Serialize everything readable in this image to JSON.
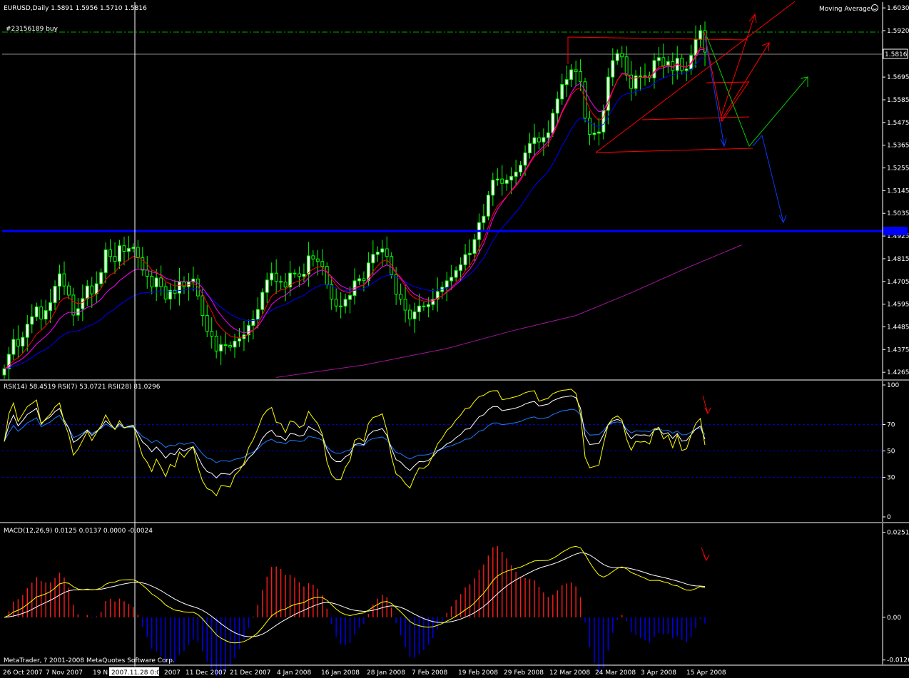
{
  "chart_data": [
    {
      "type": "candlestick",
      "title": "EURUSD,Daily  1.5891 1.5956 1.5710 1.5816",
      "indicator_label": "Moving Average",
      "order_label": "#23156189 buy",
      "current_price_label": "1.5816",
      "level_label": "1.4950",
      "ylim": [
        1.4238,
        1.6058
      ],
      "ticks": [
        1.603,
        1.592,
        1.5805,
        1.5695,
        1.5585,
        1.5475,
        1.5365,
        1.5255,
        1.5145,
        1.5035,
        1.4925,
        1.4815,
        1.4705,
        1.4595,
        1.4485,
        1.4375,
        1.4265
      ],
      "tick_labels": [
        "1.6030",
        "1.5920",
        "",
        "1.5695",
        "1.5585",
        "1.5475",
        "1.5365",
        "1.5255",
        "1.5145",
        "1.5035",
        "1.4925",
        "1.4815",
        "1.4705",
        "1.4595",
        "1.4485",
        "1.4375",
        "1.4265"
      ],
      "order_level": 1.5925,
      "current_price": 1.5816,
      "horizontal_level": 1.495,
      "closes": [
        1.4282,
        1.4352,
        1.4424,
        1.4392,
        1.4434,
        1.4498,
        1.4534,
        1.4582,
        1.4523,
        1.4564,
        1.4602,
        1.4682,
        1.4742,
        1.4683,
        1.4639,
        1.4542,
        1.4573,
        1.4622,
        1.4683,
        1.4645,
        1.4694,
        1.4748,
        1.4858,
        1.4826,
        1.4802,
        1.4878,
        1.4851,
        1.4865,
        1.487,
        1.482,
        1.476,
        1.473,
        1.4679,
        1.4722,
        1.468,
        1.462,
        1.4662,
        1.4648,
        1.4702,
        1.468,
        1.4702,
        1.4717,
        1.4635,
        1.454,
        1.4463,
        1.444,
        1.4368,
        1.4399,
        1.4395,
        1.4387,
        1.4416,
        1.4428,
        1.4446,
        1.4492,
        1.4521,
        1.4569,
        1.4652,
        1.4712,
        1.4745,
        1.4705,
        1.4702,
        1.4678,
        1.4745,
        1.4742,
        1.473,
        1.474,
        1.4829,
        1.4814,
        1.4802,
        1.4778,
        1.469,
        1.4619,
        1.4586,
        1.4586,
        1.4618,
        1.4637,
        1.4708,
        1.4718,
        1.4709,
        1.4795,
        1.4836,
        1.4847,
        1.4863,
        1.4826,
        1.4739,
        1.4643,
        1.4619,
        1.4566,
        1.4524,
        1.4558,
        1.4586,
        1.4583,
        1.4593,
        1.4619,
        1.4656,
        1.4677,
        1.4708,
        1.4725,
        1.4758,
        1.4786,
        1.4835,
        1.4841,
        1.4908,
        1.499,
        1.5021,
        1.5123,
        1.5196,
        1.5201,
        1.518,
        1.5196,
        1.5214,
        1.5235,
        1.5268,
        1.5328,
        1.5373,
        1.5401,
        1.5381,
        1.5402,
        1.5425,
        1.552,
        1.5589,
        1.5659,
        1.5683,
        1.573,
        1.5721,
        1.5672,
        1.5496,
        1.5417,
        1.5423,
        1.5429,
        1.5534,
        1.5695,
        1.5775,
        1.5809,
        1.5793,
        1.5705,
        1.564,
        1.5701,
        1.5697,
        1.5701,
        1.5691,
        1.5775,
        1.5789,
        1.575,
        1.577,
        1.5727,
        1.5786,
        1.5727,
        1.5734,
        1.58,
        1.5877,
        1.592,
        1.5816
      ],
      "ma_fast": [
        1.4282,
        1.4299,
        1.4321,
        1.4336,
        1.4356,
        1.4386,
        1.4416,
        1.445,
        1.4468,
        1.449,
        1.4518,
        1.4559,
        1.4604,
        1.4624,
        1.4627,
        1.4606,
        1.4597,
        1.4603,
        1.4624,
        1.4629,
        1.4645,
        1.4671,
        1.4714,
        1.4737,
        1.4749,
        1.4779,
        1.4796,
        1.4812,
        1.4826,
        1.4824,
        1.4808,
        1.4789,
        1.4761,
        1.4751,
        1.4733,
        1.4704,
        1.4694,
        1.4682,
        1.4687,
        1.4685,
        1.4689,
        1.4696,
        1.4681,
        1.4646,
        1.46,
        1.456,
        1.4508,
        1.4481,
        1.4459,
        1.4441,
        1.4435,
        1.4433,
        1.4436,
        1.445,
        1.4468,
        1.4495,
        1.4543,
        1.4592,
        1.4633,
        1.4652,
        1.4664,
        1.4668,
        1.4687,
        1.47,
        1.4708,
        1.4716,
        1.4748,
        1.4765,
        1.4775,
        1.4776,
        1.4752,
        1.4718,
        1.4686,
        1.4663,
        1.4654,
        1.465,
        1.4666,
        1.468,
        1.4687,
        1.4719,
        1.4753,
        1.478,
        1.4803,
        1.4809,
        1.4787,
        1.4748,
        1.4717,
        1.468,
        1.4643,
        1.4625,
        1.4617,
        1.461,
        1.4607,
        1.461,
        1.4622,
        1.4636,
        1.4657,
        1.4676,
        1.4699,
        1.4722,
        1.4757,
        1.4782,
        1.4817,
        1.4866,
        1.4908,
        1.4969,
        1.503,
        1.5071,
        1.5092,
        1.5117,
        1.5142,
        1.5166,
        1.5195,
        1.5236,
        1.5275,
        1.5309,
        1.5327,
        1.5347,
        1.537,
        1.5413,
        1.5464,
        1.5521,
        1.5563,
        1.5607,
        1.5634,
        1.5643,
        1.5594,
        1.554,
        1.5507,
        1.5485,
        1.5499,
        1.5566,
        1.5628,
        1.5679,
        1.571,
        1.5709,
        1.5687,
        1.5692,
        1.5693,
        1.5696,
        1.5694,
        1.5721,
        1.5744,
        1.5746,
        1.5754,
        1.5745,
        1.5759,
        1.5748,
        1.5744,
        1.5763,
        1.5801,
        1.584,
        1.5832
      ],
      "ma_mid": [
        1.4282,
        1.4291,
        1.4307,
        1.4318,
        1.4332,
        1.4352,
        1.4376,
        1.4402,
        1.4421,
        1.444,
        1.4462,
        1.4491,
        1.4524,
        1.4544,
        1.4556,
        1.4554,
        1.4556,
        1.4564,
        1.458,
        1.4588,
        1.4601,
        1.4619,
        1.4648,
        1.4669,
        1.4685,
        1.4709,
        1.4726,
        1.4743,
        1.4758,
        1.4765,
        1.4765,
        1.4761,
        1.475,
        1.4746,
        1.4737,
        1.4721,
        1.4714,
        1.4706,
        1.4706,
        1.4704,
        1.4704,
        1.4706,
        1.4697,
        1.4675,
        1.4644,
        1.4613,
        1.4572,
        1.4542,
        1.4515,
        1.4491,
        1.4475,
        1.4463,
        1.4456,
        1.4461,
        1.4469,
        1.4486,
        1.452,
        1.4557,
        1.4593,
        1.4613,
        1.4629,
        1.4638,
        1.4658,
        1.4674,
        1.4686,
        1.4697,
        1.4723,
        1.4741,
        1.4754,
        1.4761,
        1.475,
        1.4729,
        1.4705,
        1.4685,
        1.4674,
        1.4667,
        1.4674,
        1.4682,
        1.4687,
        1.471,
        1.4735,
        1.4756,
        1.4776,
        1.4785,
        1.4774,
        1.4747,
        1.4724,
        1.4694,
        1.4663,
        1.4643,
        1.4632,
        1.4621,
        1.4614,
        1.4615,
        1.4624,
        1.4636,
        1.4653,
        1.467,
        1.469,
        1.4711,
        1.4741,
        1.4765,
        1.4799,
        1.4845,
        1.4887,
        1.4947,
        1.5008,
        1.5055,
        1.5086,
        1.5116,
        1.5145,
        1.5173,
        1.5204,
        1.5243,
        1.5282,
        1.5317,
        1.5338,
        1.536,
        1.5384,
        1.5425,
        1.5473,
        1.5528,
        1.5572,
        1.5618,
        1.5652,
        1.5666,
        1.563,
        1.5585,
        1.5552,
        1.5527,
        1.5531,
        1.5579,
        1.5632,
        1.568,
        1.5713,
        1.5712,
        1.569,
        1.5691,
        1.5692,
        1.5694,
        1.5693,
        1.5715,
        1.5736,
        1.574,
        1.5749,
        1.5743,
        1.5755,
        1.5746,
        1.5743,
        1.5759,
        1.5793,
        1.583,
        1.5826
      ],
      "ma_slow": [
        1.4282,
        1.4286,
        1.4295,
        1.4301,
        1.431,
        1.4322,
        1.4336,
        1.4353,
        1.4365,
        1.4377,
        1.4392,
        1.4411,
        1.4433,
        1.4448,
        1.4459,
        1.4461,
        1.4466,
        1.4474,
        1.4487,
        1.4495,
        1.4506,
        1.4521,
        1.4543,
        1.4559,
        1.4573,
        1.4591,
        1.4606,
        1.4621,
        1.4635,
        1.4644,
        1.4649,
        1.4651,
        1.4652,
        1.4656,
        1.4657,
        1.4654,
        1.4656,
        1.4656,
        1.4661,
        1.4663,
        1.4667,
        1.4671,
        1.4668,
        1.4657,
        1.464,
        1.4622,
        1.4599,
        1.458,
        1.4563,
        1.4547,
        1.4535,
        1.4525,
        1.4518,
        1.4516,
        1.4516,
        1.452,
        1.4533,
        1.4549,
        1.4566,
        1.4576,
        1.4586,
        1.4593,
        1.4606,
        1.4618,
        1.4628,
        1.4637,
        1.4655,
        1.4669,
        1.4681,
        1.4689,
        1.4689,
        1.4683,
        1.4674,
        1.4666,
        1.4661,
        1.4658,
        1.4662,
        1.4666,
        1.467,
        1.4683,
        1.4698,
        1.4712,
        1.4726,
        1.4734,
        1.4735,
        1.4726,
        1.4717,
        1.4704,
        1.4689,
        1.4679,
        1.4673,
        1.4667,
        1.4662,
        1.4661,
        1.4664,
        1.4667,
        1.4675,
        1.4683,
        1.4694,
        1.4706,
        1.4724,
        1.4739,
        1.4761,
        1.4791,
        1.4819,
        1.486,
        1.4902,
        1.4937,
        1.4963,
        1.4989,
        1.5015,
        1.5041,
        1.5069,
        1.5102,
        1.5136,
        1.5168,
        1.5191,
        1.5214,
        1.5239,
        1.5275,
        1.5316,
        1.5362,
        1.5401,
        1.5442,
        1.5476,
        1.5497,
        1.5488,
        1.5473,
        1.5462,
        1.5454,
        1.5466,
        1.5503,
        1.5541,
        1.5578,
        1.5604,
        1.5614,
        1.5615,
        1.5626,
        1.5634,
        1.5642,
        1.5647,
        1.5666,
        1.5682,
        1.569,
        1.57,
        1.5703,
        1.5714,
        1.5715,
        1.5716,
        1.5731,
        1.5757,
        1.5785,
        1.579
      ],
      "long_ma_points": [
        [
          59,
          1.424
        ],
        [
          78,
          1.43
        ],
        [
          96,
          1.438
        ],
        [
          110,
          1.4465
        ],
        [
          124,
          1.454
        ],
        [
          136,
          1.465
        ],
        [
          148,
          1.477
        ],
        [
          160,
          1.4882
        ]
      ]
    },
    {
      "type": "line",
      "title": "RSI(14) 58.4519  RSI(7) 53.0721  RSI(28) 81.0296",
      "ylim": [
        0,
        100
      ],
      "ticks": [
        100,
        70,
        50,
        30,
        0
      ],
      "tick_labels": [
        "100",
        "70",
        "50",
        "30",
        "0"
      ],
      "levels": [
        70,
        50,
        30
      ],
      "series_count": 3
    },
    {
      "type": "bar+line",
      "title": "MACD(12,26,9) 0.0125  0.0137  0.0000  -0.0024",
      "ylim": [
        -0.0135,
        0.0265
      ],
      "ticks": [
        0.0251,
        0.0,
        -0.0126
      ],
      "tick_labels": [
        "0.0251",
        "0.00",
        "-0.0126"
      ]
    }
  ],
  "time_axis": {
    "labels": [
      "26 Oct 2007",
      "7 Nov 2007",
      "19 N",
      "2007",
      "11 Dec 2007",
      "21 Dec 2007",
      "4 Jan 2008",
      "16 Jan 2008",
      "28 Jan 2008",
      "7 Feb 2008",
      "19 Feb 2008",
      "29 Feb 2008",
      "12 Mar 2008",
      "24 Mar 2008",
      "3 Apr 2008",
      "15 Apr 2008"
    ],
    "crosshair_label": "2007.11.28 0:00"
  },
  "copyright": "MetaTrader, ? 2001-2008 MetaQuotes Software Corp.",
  "colors": {
    "background": "#000000",
    "bull": "#ffffff",
    "wick": "#00ff00",
    "ma_fast": "#ff0000",
    "ma_mid": "#ff00ff",
    "ma_slow": "#0000ff",
    "ma_long": "#a0169a",
    "level": "#0000ff",
    "order": "#00aa00",
    "rsi_fast": "#ffff00",
    "rsi_mid": "#ffffff",
    "rsi_slow": "#1e7cff",
    "macd_pos": "#ff1a1a",
    "macd_neg": "#0000ff",
    "signal": "#ffffff",
    "macd_line": "#ffff00"
  }
}
